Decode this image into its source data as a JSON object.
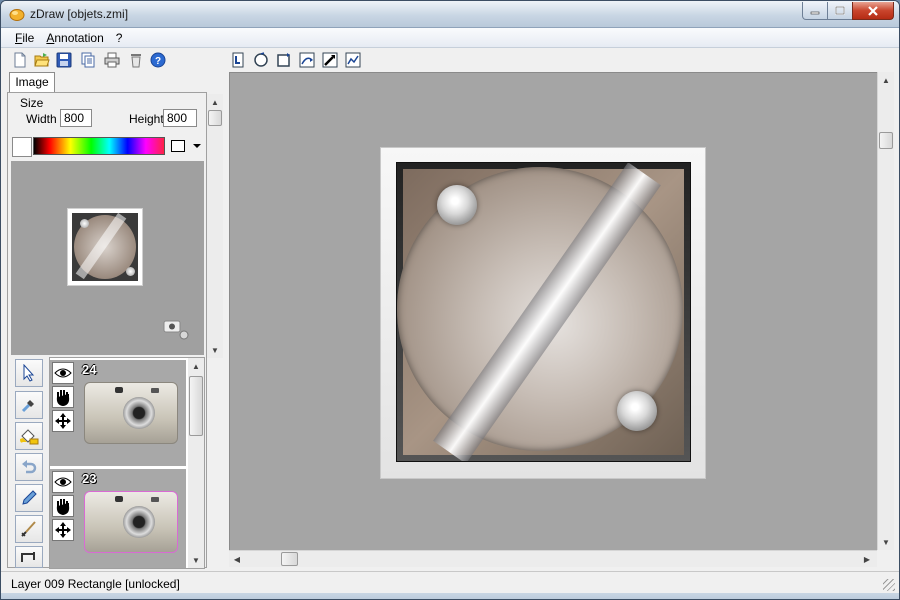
{
  "window": {
    "title": "zDraw [objets.zmi]"
  },
  "menu": {
    "items": [
      {
        "label": "File",
        "accel": "F",
        "rest": "ile"
      },
      {
        "label": "Annotation",
        "accel": "A",
        "rest": "nnotation"
      },
      {
        "label": "?",
        "accel": "",
        "rest": "?"
      }
    ]
  },
  "toolbar": {
    "left_icons": [
      "new-file-icon",
      "open-folder-icon",
      "save-icon",
      "copy-icon",
      "print-icon",
      "delete-icon",
      "help-icon"
    ],
    "right_icons": [
      "rotate-page-icon",
      "rotate-circle-icon",
      "rotate-square-icon",
      "flip-icon",
      "pick-icon",
      "curve-icon"
    ]
  },
  "panel": {
    "tab_label": "Image",
    "size_group_label": "Size",
    "width_label": "Width",
    "width_value": "800",
    "height_label": "Height",
    "height_value": "800"
  },
  "layers": [
    {
      "number": "24",
      "visible": true
    },
    {
      "number": "23",
      "visible": true
    }
  ],
  "tools": [
    "select-arrow-icon",
    "eyedropper-icon",
    "fill-bucket-icon",
    "undo-icon",
    "pencil-icon",
    "brush-icon",
    "crop-icon"
  ],
  "status": {
    "text": "Layer 009 Rectangle [unlocked]"
  },
  "colors": {
    "canvas_bg": "#a5a5a5",
    "titlebar": "#c9d6e4",
    "close_button": "#c9452d"
  }
}
